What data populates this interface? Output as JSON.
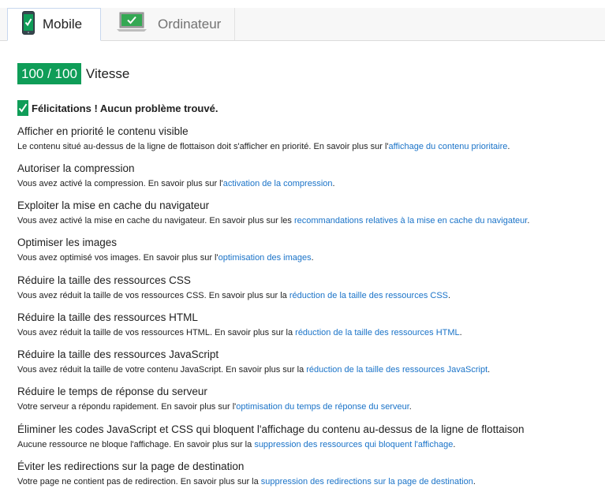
{
  "tabs": [
    {
      "label": "Mobile",
      "active": true,
      "icon": "smartphone-check-icon"
    },
    {
      "label": "Ordinateur",
      "active": false,
      "icon": "laptop-check-icon"
    }
  ],
  "score": {
    "value": "100 / 100",
    "label": "Vitesse",
    "color": "#0f9d58"
  },
  "congrats": "Félicitations ! Aucun problème trouvé.",
  "rules": [
    {
      "title": "Afficher en priorité le contenu visible",
      "desc": "Le contenu situé au-dessus de la ligne de flottaison doit s'afficher en priorité. En savoir plus sur l'",
      "link": "affichage du contenu prioritaire",
      "tail": "."
    },
    {
      "title": "Autoriser la compression",
      "desc": "Vous avez activé la compression. En savoir plus sur l'",
      "link": "activation de la compression",
      "tail": "."
    },
    {
      "title": "Exploiter la mise en cache du navigateur",
      "desc": "Vous avez activé la mise en cache du navigateur. En savoir plus sur les ",
      "link": "recommandations relatives à la mise en cache du navigateur",
      "tail": "."
    },
    {
      "title": "Optimiser les images",
      "desc": "Vous avez optimisé vos images. En savoir plus sur l'",
      "link": "optimisation des images",
      "tail": "."
    },
    {
      "title": "Réduire la taille des ressources CSS",
      "desc": "Vous avez réduit la taille de vos ressources CSS. En savoir plus sur la ",
      "link": "réduction de la taille des ressources CSS",
      "tail": "."
    },
    {
      "title": "Réduire la taille des ressources HTML",
      "desc": "Vous avez réduit la taille de vos ressources HTML. En savoir plus sur la ",
      "link": "réduction de la taille des ressources HTML",
      "tail": "."
    },
    {
      "title": "Réduire la taille des ressources JavaScript",
      "desc": "Vous avez réduit la taille de votre contenu JavaScript. En savoir plus sur la ",
      "link": "réduction de la taille des ressources JavaScript",
      "tail": "."
    },
    {
      "title": "Réduire le temps de réponse du serveur",
      "desc": "Votre serveur a répondu rapidement. En savoir plus sur l'",
      "link": "optimisation du temps de réponse du serveur",
      "tail": "."
    },
    {
      "title": "Éliminer les codes JavaScript et CSS qui bloquent l'affichage du contenu au-dessus de la ligne de flottaison",
      "desc": "Aucune ressource ne bloque l'affichage. En savoir plus sur la ",
      "link": "suppression des ressources qui bloquent l'affichage",
      "tail": "."
    },
    {
      "title": "Éviter les redirections sur la page de destination",
      "desc": "Votre page ne contient pas de redirection. En savoir plus sur la ",
      "link": "suppression des redirections sur la page de destination",
      "tail": "."
    }
  ]
}
